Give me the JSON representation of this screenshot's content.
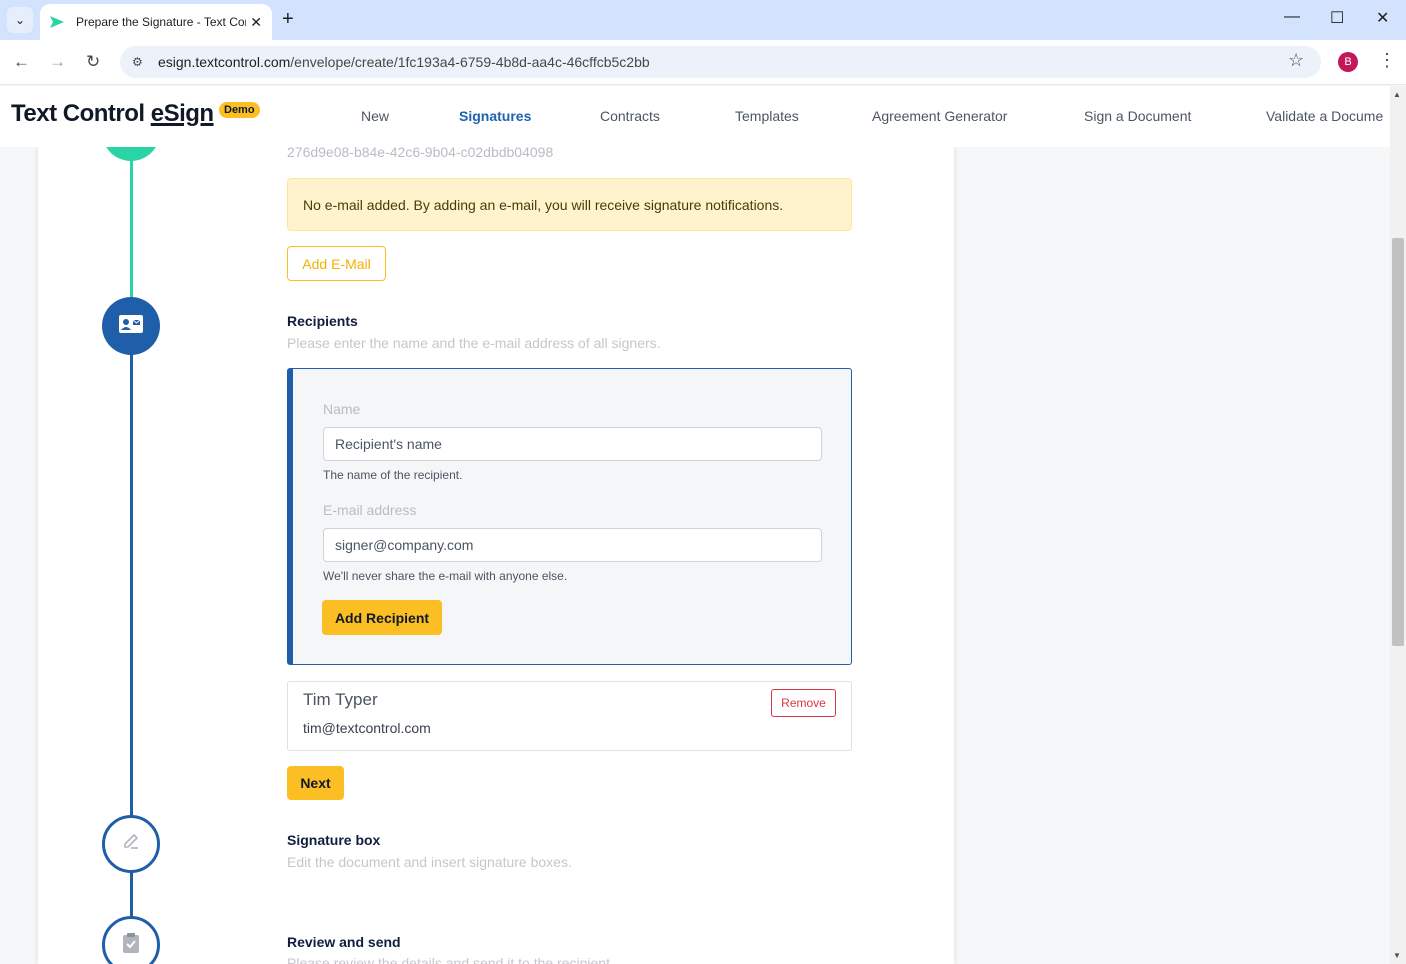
{
  "browser": {
    "tab_title": "Prepare the Signature - Text Control eSign",
    "url_domain": "esign.textcontrol.com",
    "url_path": "/envelope/create/1fc193a4-6759-4b8d-aa4c-46cffcb5c2bb",
    "profile_initial": "B",
    "icons": {
      "tab_menu": "chevron-down-icon",
      "close": "close-icon",
      "new_tab": "plus-icon",
      "back": "back-arrow-icon",
      "forward": "forward-arrow-icon",
      "reload": "reload-icon",
      "site_info": "site-settings-icon",
      "bookmark": "star-icon",
      "menu": "kebab-menu-icon"
    },
    "accent": "#d3e3fd"
  },
  "header": {
    "logo_text": "Text Control",
    "logo_esign": "eSign",
    "demo_badge": "Demo",
    "nav": [
      "New",
      "Signatures",
      "Contracts",
      "Templates",
      "Agreement Generator",
      "Sign a Document",
      "Validate a Docume"
    ],
    "active_nav": "Signatures"
  },
  "envelope": {
    "id_fragment": "276d9e08-b84e-42c6-9b04-c02dbdb04098",
    "alert_text": "No e-mail added. By adding an e-mail, you will receive signature notifications.",
    "add_email_label": "Add E-Mail"
  },
  "recipients": {
    "title": "Recipients",
    "description": "Please enter the name and the e-mail address of all signers.",
    "name_label": "Name",
    "name_placeholder": "Recipient's name",
    "name_help": "The name of the recipient.",
    "email_label": "E-mail address",
    "email_placeholder": "signer@company.com",
    "email_help": "We'll never share the e-mail with anyone else.",
    "add_button": "Add Recipient",
    "list": [
      {
        "name": "Tim Typer",
        "email": "tim@textcontrol.com",
        "remove_label": "Remove"
      }
    ],
    "next_label": "Next"
  },
  "steps": [
    {
      "title": "Signature box",
      "description": "Edit the document and insert signature boxes.",
      "icon": "pencil-icon"
    },
    {
      "title": "Review and send",
      "description": "Please review the details and send it to the recipient.",
      "icon": "clipboard-check-icon"
    }
  ],
  "colors": {
    "brand_blue": "#1f5ea8",
    "done_teal": "#2bd4a4",
    "button_yellow": "#fbbf24",
    "danger": "#dc3545"
  }
}
